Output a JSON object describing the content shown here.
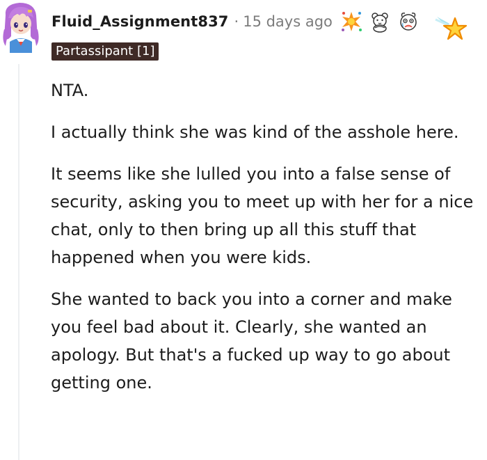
{
  "comment": {
    "author": "Fluid_Assignment837",
    "separator": "·",
    "time": "15 days ago",
    "flair": "Partassipant [1]",
    "awards": [
      "party-popper-award-icon",
      "teddy-bear-award-icon",
      "crying-face-award-icon",
      "star-award-icon"
    ],
    "paragraphs": [
      "NTA.",
      "I actually think she was kind of the asshole here.",
      "It seems like she lulled you into a false sense of security, asking you to meet up with her for a nice chat, only to then bring up all this stuff that happened when you were kids.",
      "She wanted to back you into a corner and make you feel bad about it. Clearly, she wanted an apology. But that's a fucked up way to go about getting one."
    ]
  },
  "colors": {
    "flair_bg": "#3f2a26",
    "flair_text": "#ffffff",
    "meta_text": "#7c7c7c",
    "body_text": "#1c1c1c",
    "thread_line": "#edeff1"
  }
}
